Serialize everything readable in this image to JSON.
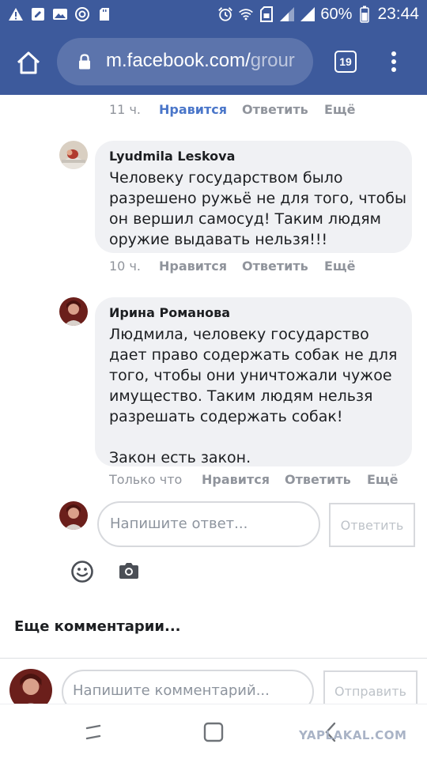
{
  "status_bar": {
    "battery_percent": "60%",
    "time": "23:44",
    "left_icons": [
      "warning-icon",
      "edit-icon",
      "image-icon",
      "vpn-icon",
      "sdcard-icon"
    ],
    "right_icons": [
      "alarm-icon",
      "wifi-icon",
      "sim-icon",
      "signal-icon",
      "signal-icon",
      "battery-icon"
    ]
  },
  "browser": {
    "url_main": "m.facebook.com/",
    "url_rest": "grour",
    "tab_count": "19"
  },
  "comments": {
    "prev_actions": {
      "time": "11 ч.",
      "like": "Нравится",
      "reply": "Ответить",
      "more": "Ещё"
    },
    "items": [
      {
        "author": "Lyudmila Leskova",
        "text": "Человеку государством было\nразрешено ружьё не для того, чтобы\nон вершил самосуд! Таким людям\nоружие выдавать нельзя!!!",
        "time": "10 ч.",
        "like": "Нравится",
        "reply": "Ответить",
        "more": "Ещё"
      },
      {
        "author": "Ирина Романова",
        "text": "Людмила, человеку государство\nдает право содержать собак не для\nтого, чтобы они уничтожали чужое\nимущество. Таким людям нельзя\nразрешать содержать собак!\n\nЗакон есть закон.",
        "time": "Только что",
        "like": "Нравится",
        "reply": "Ответить",
        "more": "Ещё"
      }
    ]
  },
  "reply_box": {
    "placeholder": "Напишите ответ...",
    "button": "Ответить"
  },
  "more_comments": "Еще комментарии...",
  "comment_box": {
    "placeholder": "Напишите комментарий...",
    "button": "Отправить"
  },
  "watermark": "YAPLAKAL.COM",
  "colors": {
    "header": "#3d5a9c",
    "bubble": "#f0f1f4",
    "like_active": "#4a76c9",
    "meta": "#90949c"
  }
}
